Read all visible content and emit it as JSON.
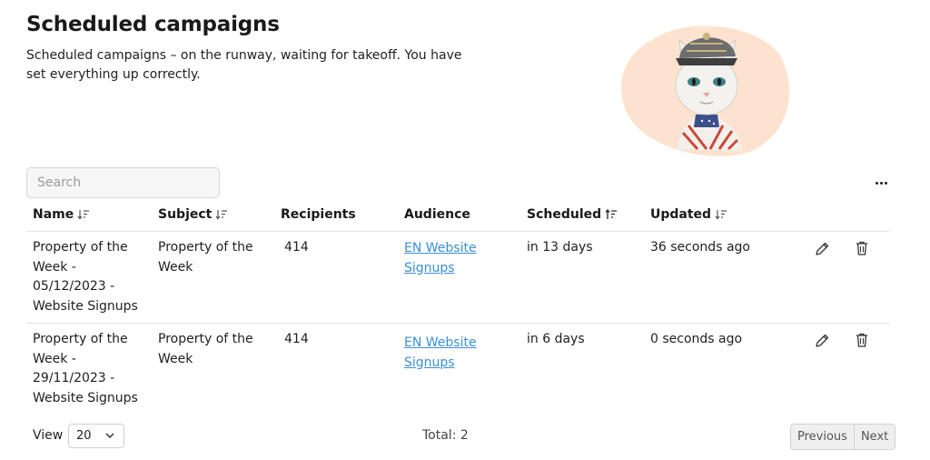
{
  "header": {
    "title": "Scheduled campaigns",
    "description": "Scheduled campaigns – on the runway, waiting for takeoff. You have set everything up correctly."
  },
  "search": {
    "placeholder": "Search",
    "value": ""
  },
  "toolbar": {
    "more_icon": "more-horizontal-icon"
  },
  "table": {
    "columns": {
      "name": "Name",
      "subject": "Subject",
      "recipients": "Recipients",
      "audience": "Audience",
      "scheduled": "Scheduled",
      "updated": "Updated"
    },
    "rows": [
      {
        "name": "Property of the Week - 05/12/2023 - Website Signups",
        "subject": "Property of the Week",
        "recipients": "414",
        "audience": "EN Website Signups",
        "scheduled": "in 13 days",
        "updated": "36 seconds ago"
      },
      {
        "name": "Property of the Week - 29/11/2023 - Website Signups",
        "subject": "Property of the Week",
        "recipients": "414",
        "audience": "EN Website Signups",
        "scheduled": "in 6 days",
        "updated": "0 seconds ago"
      }
    ]
  },
  "footer": {
    "view_label": "View",
    "page_size": "20",
    "total": "Total: 2",
    "previous": "Previous",
    "next": "Next"
  },
  "colors": {
    "link": "#3a8fd6",
    "blob": "#fde3cf"
  }
}
